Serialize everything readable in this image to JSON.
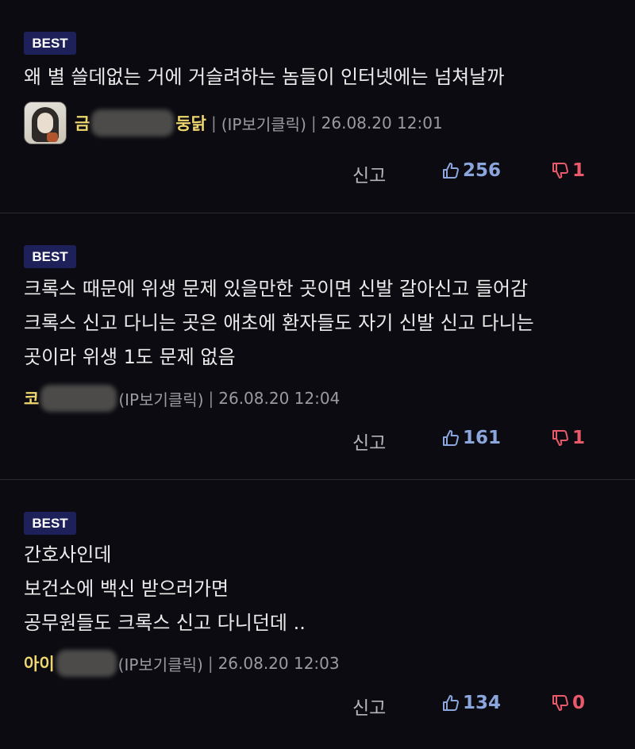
{
  "comments": [
    {
      "badge": "BEST",
      "lines": [
        "왜 별 쓸데없는 거에 거슬려하는 놈들이 인터넷에는 넘쳐날까"
      ],
      "nick_start": "금",
      "nick_end": "둥닭",
      "ip_label": "(IP보기클릭)",
      "date": "26.08.20 12:01",
      "report_label": "신고",
      "likes": "256",
      "dislikes": "1"
    },
    {
      "badge": "BEST",
      "lines": [
        "크록스 때문에 위생 문제 있을만한 곳이면 신발 갈아신고 들어감",
        "크록스 신고 다니는 곳은 애초에 환자들도 자기 신발 신고 다니는",
        "곳이라 위생 1도 문제 없음"
      ],
      "nick_start": "코",
      "nick_end": "",
      "ip_label": "(IP보기클릭)",
      "date": "26.08.20 12:04",
      "report_label": "신고",
      "likes": "161",
      "dislikes": "1"
    },
    {
      "badge": "BEST",
      "lines": [
        "간호사인데",
        "보건소에 백신 받으러가면",
        "공무원들도 크록스 신고 다니던데 .."
      ],
      "nick_start": "아이",
      "nick_end": "",
      "ip_label": "(IP보기클릭)",
      "date": "26.08.20 12:03",
      "report_label": "신고",
      "likes": "134",
      "dislikes": "0"
    }
  ],
  "meta_separator": "|",
  "colors": {
    "background": "#0c0b11",
    "badge": "#1e2159",
    "nickname": "#f0d870",
    "like": "#8ba6dc",
    "dislike": "#e85a6a"
  },
  "icons": {
    "like": "thumbs-up-icon",
    "dislike": "thumbs-down-icon",
    "avatar": "avatar"
  }
}
